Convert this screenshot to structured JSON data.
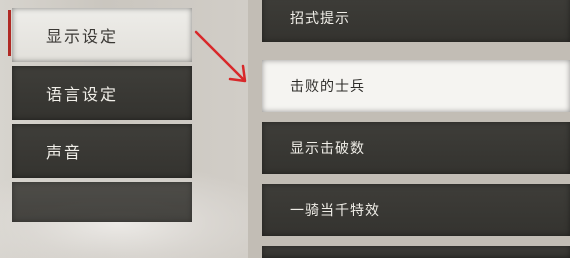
{
  "left_menu": {
    "items": [
      {
        "label": "显示设定",
        "selected": true
      },
      {
        "label": "语言设定",
        "selected": false
      },
      {
        "label": "声音",
        "selected": false
      },
      {
        "label": "",
        "selected": false
      }
    ]
  },
  "right_menu": {
    "items": [
      {
        "label": "招式提示",
        "highlighted": false
      },
      {
        "label": "击败的士兵",
        "highlighted": true
      },
      {
        "label": "显示击破数",
        "highlighted": false
      },
      {
        "label": "一骑当千特效",
        "highlighted": false
      },
      {
        "label": "",
        "highlighted": false
      }
    ]
  },
  "colors": {
    "accent_red": "#b02a24",
    "arrow_red": "#d8282a",
    "panel_dark": "#3a3935",
    "panel_light": "#f5f4f1"
  },
  "icons": {
    "annotation_arrow": "red-arrow-icon"
  }
}
